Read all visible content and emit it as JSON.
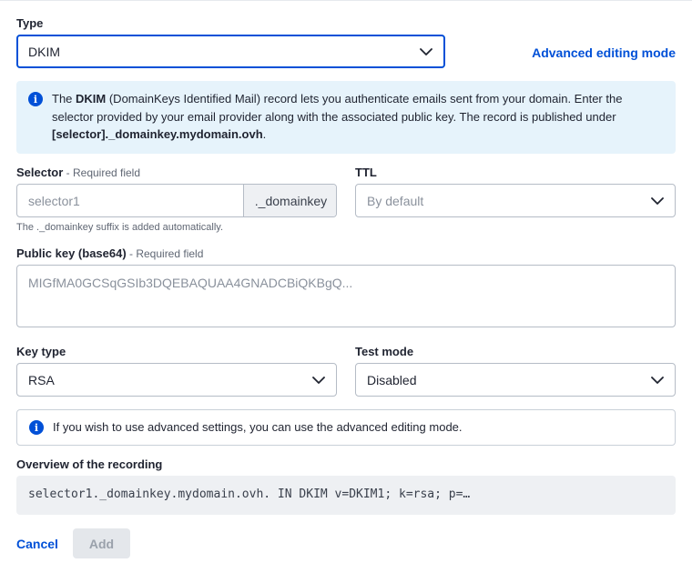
{
  "type": {
    "label": "Type",
    "selected": "DKIM",
    "advanced_link": "Advanced editing mode"
  },
  "info_banner": {
    "prefix": "The ",
    "bold_term": "DKIM",
    "text": " (DomainKeys Identified Mail) record lets you authenticate emails sent from your domain. Enter the selector provided by your email provider along with the associated public key. The record is published under ",
    "bold_path": "[selector]._domainkey.mydomain.ovh",
    "suffix": "."
  },
  "selector": {
    "label": "Selector",
    "required": " - Required field",
    "placeholder": "selector1",
    "suffix_addon": "._domainkey",
    "hint": "The ._domainkey suffix is added automatically."
  },
  "ttl": {
    "label": "TTL",
    "placeholder": "By default"
  },
  "public_key": {
    "label": "Public key (base64)",
    "required": " - Required field",
    "placeholder": "MIGfMA0GCSqGSIb3DQEBAQUAA4GNADCBiQKBgQ..."
  },
  "key_type": {
    "label": "Key type",
    "selected": "RSA"
  },
  "test_mode": {
    "label": "Test mode",
    "selected": "Disabled"
  },
  "advanced_notice": {
    "text": "If you wish to use advanced settings, you can use the advanced editing mode."
  },
  "overview": {
    "label": "Overview of the recording",
    "value": "selector1._domainkey.mydomain.ovh. IN DKIM v=DKIM1; k=rsa; p=…"
  },
  "actions": {
    "cancel": "Cancel",
    "add": "Add"
  },
  "colors": {
    "accent": "#0050d7",
    "info_background": "#e6f3fb",
    "disabled_button": "#e4e7eb",
    "readonly_background": "#eef0f3"
  }
}
